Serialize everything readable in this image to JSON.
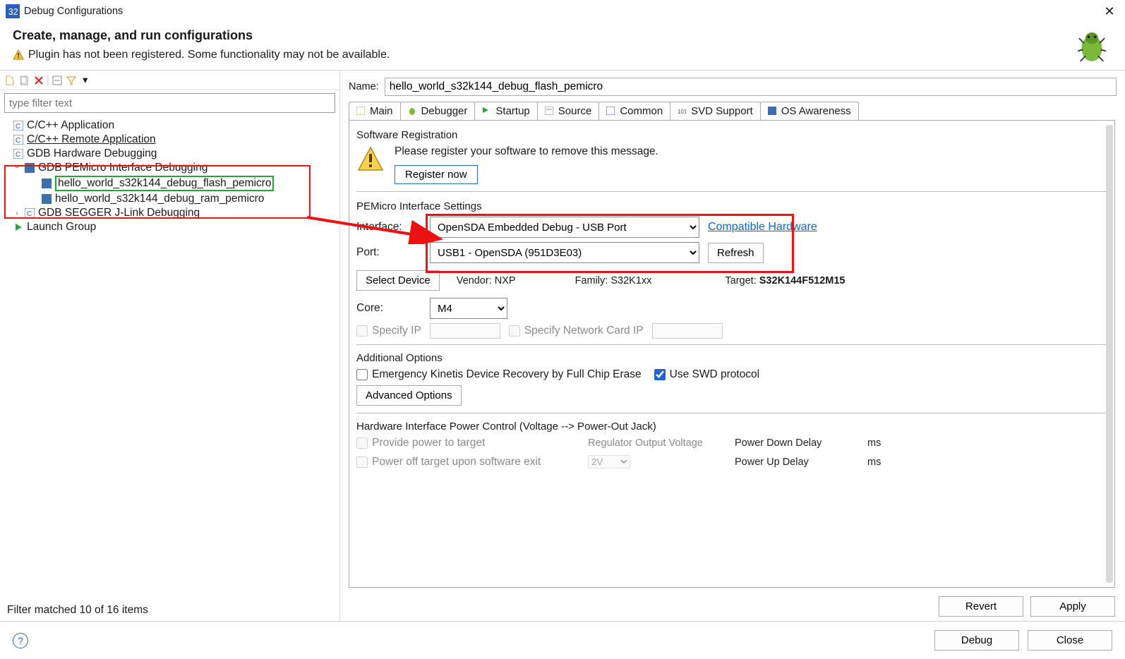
{
  "window": {
    "title": "Debug Configurations"
  },
  "header": {
    "title": "Create, manage, and run configurations",
    "warning": "Plugin has not been registered. Some functionality may not be available."
  },
  "tree": {
    "filter_placeholder": "type filter text",
    "items": {
      "cpp_app": "C/C++ Application",
      "cpp_remote": "C/C++ Remote Application",
      "gdb_hw": "GDB Hardware Debugging",
      "gdb_pe": "GDB PEMicro Interface Debugging",
      "pe_flash": "hello_world_s32k144_debug_flash_pemicro",
      "pe_ram": "hello_world_s32k144_debug_ram_pemicro",
      "gdb_segger": "GDB SEGGER J-Link Debugging",
      "launch_grp": "Launch Group"
    },
    "filter_status": "Filter matched 10 of 16 items"
  },
  "form": {
    "name_label": "Name:",
    "name_value": "hello_world_s32k144_debug_flash_pemicro"
  },
  "tabs": {
    "main": "Main",
    "debugger": "Debugger",
    "startup": "Startup",
    "source": "Source",
    "common": "Common",
    "svd": "SVD Support",
    "os": "OS Awareness"
  },
  "reg": {
    "title": "Software Registration",
    "msg": "Please register your software to remove this message.",
    "btn": "Register now"
  },
  "pe": {
    "section": "PEMicro Interface Settings",
    "interface_label": "Interface:",
    "interface_value": "OpenSDA Embedded Debug - USB Port",
    "compat": "Compatible Hardware",
    "port_label": "Port:",
    "port_value": "USB1 - OpenSDA (951D3E03)",
    "refresh": "Refresh",
    "select_device": "Select Device",
    "vendor_label": "Vendor:",
    "vendor_value": "NXP",
    "family_label": "Family:",
    "family_value": "S32K1xx",
    "target_label": "Target:",
    "target_value": "S32K144F512M15",
    "core_label": "Core:",
    "core_value": "M4",
    "specify_ip": "Specify IP",
    "specify_nic": "Specify Network Card IP"
  },
  "add": {
    "section": "Additional Options",
    "emer": "Emergency Kinetis Device Recovery by Full Chip Erase",
    "swd": "Use SWD protocol",
    "adv": "Advanced Options"
  },
  "power": {
    "section": "Hardware Interface Power Control (Voltage --> Power-Out Jack)",
    "provide": "Provide power to target",
    "reg_out": "Regulator Output Voltage",
    "pdown": "Power Down Delay",
    "poff": "Power off target upon software exit",
    "volt": "2V",
    "pup": "Power Up Delay",
    "ms": "ms"
  },
  "buttons": {
    "revert": "Revert",
    "apply": "Apply",
    "debug": "Debug",
    "close": "Close"
  }
}
